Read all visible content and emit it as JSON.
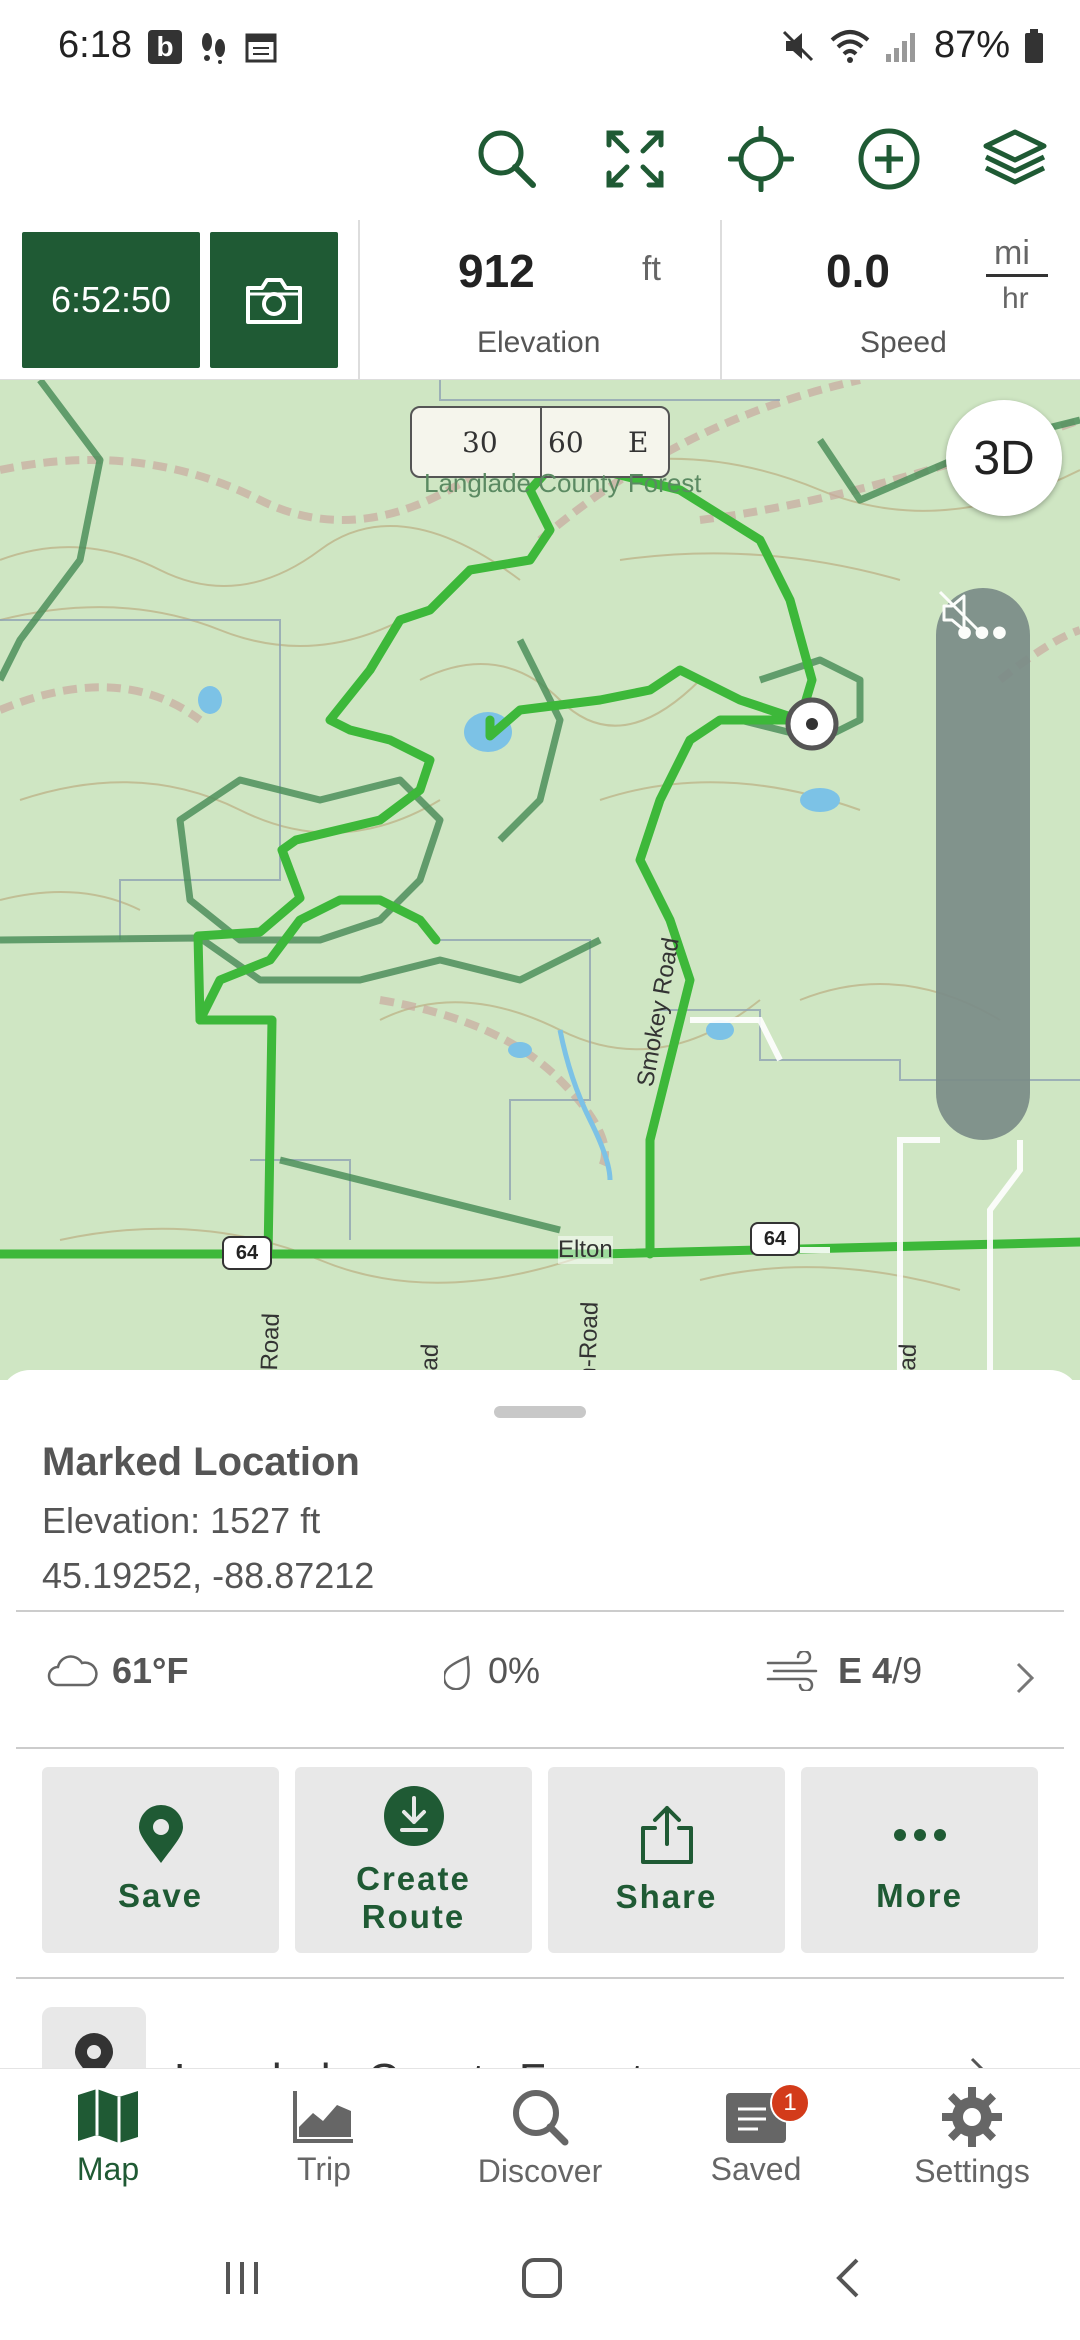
{
  "status_bar": {
    "time": "6:18",
    "b_icon_text": "b",
    "battery": "87%"
  },
  "toolbar": {
    "icons": [
      "search-icon",
      "fullscreen-icon",
      "locate-icon",
      "add-icon",
      "layers-icon"
    ]
  },
  "info_bar": {
    "timer": "6:52:50",
    "elevation_value": "912",
    "elevation_unit": "ft",
    "elevation_label": "Elevation",
    "speed_value": "0.0",
    "speed_unit_top": "mi",
    "speed_unit_bottom": "hr",
    "speed_label": "Speed"
  },
  "map": {
    "compass": {
      "left": "30",
      "mid": "60",
      "right": "E"
    },
    "btn_3d": "3D",
    "side_dots": "•••",
    "labels": {
      "forest": "Langlade County Forest",
      "smokey_road": "Smokey Road",
      "elton": "Elton",
      "road_left": "Road",
      "road_mid": "ad",
      "road_mid2": "n-Road",
      "road_right": "ad"
    },
    "shields": [
      "64",
      "64"
    ],
    "route_color": "#3db83a",
    "land_color": "#cfe6c3"
  },
  "sheet": {
    "title": "Marked Location",
    "elevation": "Elevation: 1527 ft",
    "coords": "45.19252, -88.87212",
    "weather": {
      "temp": "61°F",
      "precip": "0%",
      "wind_dir": "E",
      "wind_speed": "4",
      "wind_sep": "/",
      "wind_gust": "9"
    },
    "actions": [
      {
        "label": "Save",
        "icon": "location-pin-icon"
      },
      {
        "label": "Create\nRoute",
        "icon": "download-icon"
      },
      {
        "label": "Share",
        "icon": "share-icon"
      },
      {
        "label": "More",
        "icon": "more-dots-icon"
      }
    ],
    "nearby_title": "Langlade County Forest"
  },
  "bottom_nav": {
    "items": [
      {
        "label": "Map",
        "icon": "map-icon",
        "active": true
      },
      {
        "label": "Trip",
        "icon": "trip-chart-icon",
        "active": false
      },
      {
        "label": "Discover",
        "icon": "discover-search-icon",
        "active": false
      },
      {
        "label": "Saved",
        "icon": "saved-icon",
        "active": false,
        "badge": "1"
      },
      {
        "label": "Settings",
        "icon": "gear-icon",
        "active": false
      }
    ]
  },
  "colors": {
    "brand_green": "#1f5a34",
    "badge_red": "#d33b1a"
  }
}
